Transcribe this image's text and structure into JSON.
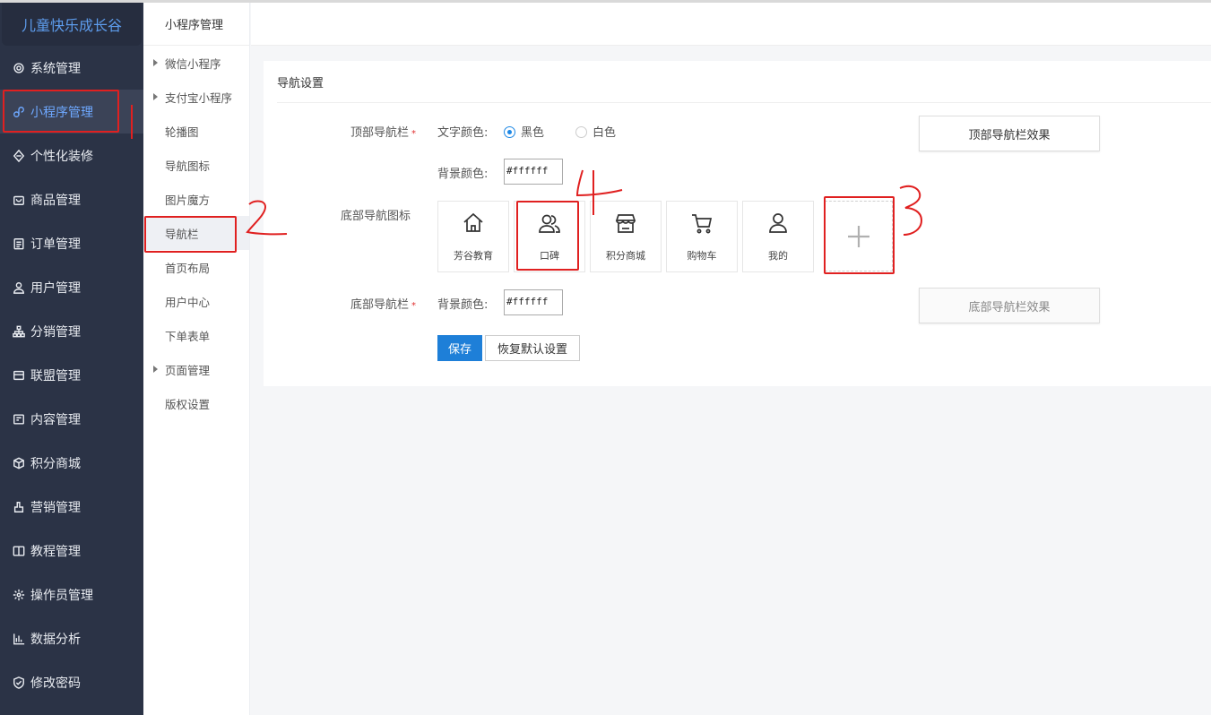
{
  "brand": "儿童快乐成长谷",
  "sidebar": {
    "items": [
      {
        "label": "系统管理",
        "icon": "gear-icon"
      },
      {
        "label": "小程序管理",
        "icon": "link-icon"
      },
      {
        "label": "个性化装修",
        "icon": "diamond-icon"
      },
      {
        "label": "商品管理",
        "icon": "bag-icon"
      },
      {
        "label": "订单管理",
        "icon": "clipboard-icon"
      },
      {
        "label": "用户管理",
        "icon": "user-icon"
      },
      {
        "label": "分销管理",
        "icon": "hierarchy-icon"
      },
      {
        "label": "联盟管理",
        "icon": "store-icon"
      },
      {
        "label": "内容管理",
        "icon": "document-icon"
      },
      {
        "label": "积分商城",
        "icon": "cube-icon"
      },
      {
        "label": "营销管理",
        "icon": "hand-icon"
      },
      {
        "label": "教程管理",
        "icon": "book-icon"
      },
      {
        "label": "操作员管理",
        "icon": "cog-icon"
      },
      {
        "label": "数据分析",
        "icon": "bar-chart-icon"
      },
      {
        "label": "修改密码",
        "icon": "shield-check-icon"
      }
    ]
  },
  "submenu": {
    "title": "小程序管理",
    "items": [
      {
        "label": "微信小程序"
      },
      {
        "label": "支付宝小程序"
      },
      {
        "label": "轮播图"
      },
      {
        "label": "导航图标"
      },
      {
        "label": "图片魔方"
      },
      {
        "label": "导航栏"
      },
      {
        "label": "首页布局"
      },
      {
        "label": "用户中心"
      },
      {
        "label": "下单表单"
      },
      {
        "label": "页面管理"
      },
      {
        "label": "版权设置"
      }
    ]
  },
  "main": {
    "title": "导航设置",
    "top_nav_label": "顶部导航栏",
    "text_color_label": "文字颜色:",
    "color_black": "黑色",
    "color_white": "白色",
    "bg_color_label": "背景颜色:",
    "top_bg_value": "#ffffff",
    "top_effect_button": "顶部导航栏效果",
    "bottom_icons_label": "底部导航图标",
    "nav_tiles": [
      {
        "label": "芳谷教育",
        "icon": "home-icon"
      },
      {
        "label": "口碑",
        "icon": "users-icon"
      },
      {
        "label": "积分商城",
        "icon": "shop-icon"
      },
      {
        "label": "购物车",
        "icon": "cart-icon"
      },
      {
        "label": "我的",
        "icon": "person-icon"
      }
    ],
    "add_tile_icon": "plus-icon",
    "bottom_nav_label": "底部导航栏",
    "bottom_bg_label": "背景颜色:",
    "bottom_bg_value": "#ffffff",
    "bottom_effect_button": "底部导航栏效果",
    "save_button": "保存",
    "reset_button": "恢复默认设置"
  },
  "annotation_color": "#e02020"
}
